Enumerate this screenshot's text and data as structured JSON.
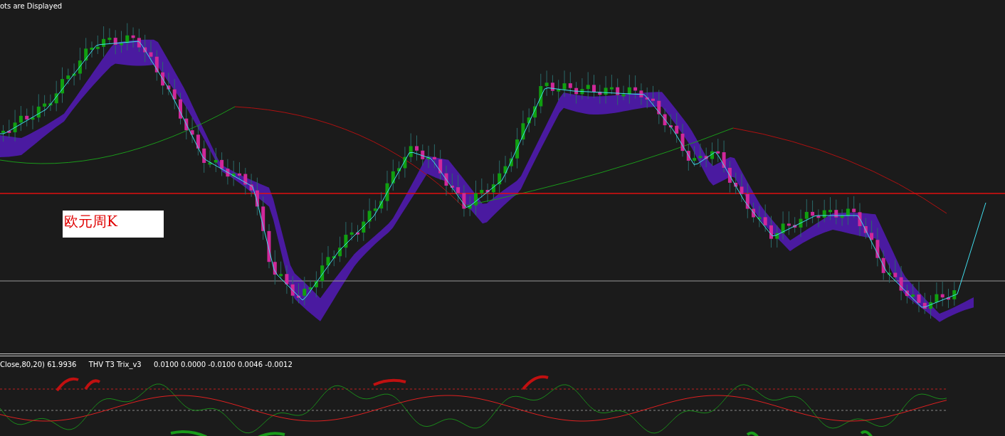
{
  "chart": {
    "legend": "ots are Displayed",
    "label": "欧元周K"
  },
  "indicator_panel": {
    "params": "Close,80,20) 61.9936",
    "name": "THV T3 Trix_v3",
    "values": "0.0100 0.0000 -0.0100 0.0046 -0.0012"
  }
}
